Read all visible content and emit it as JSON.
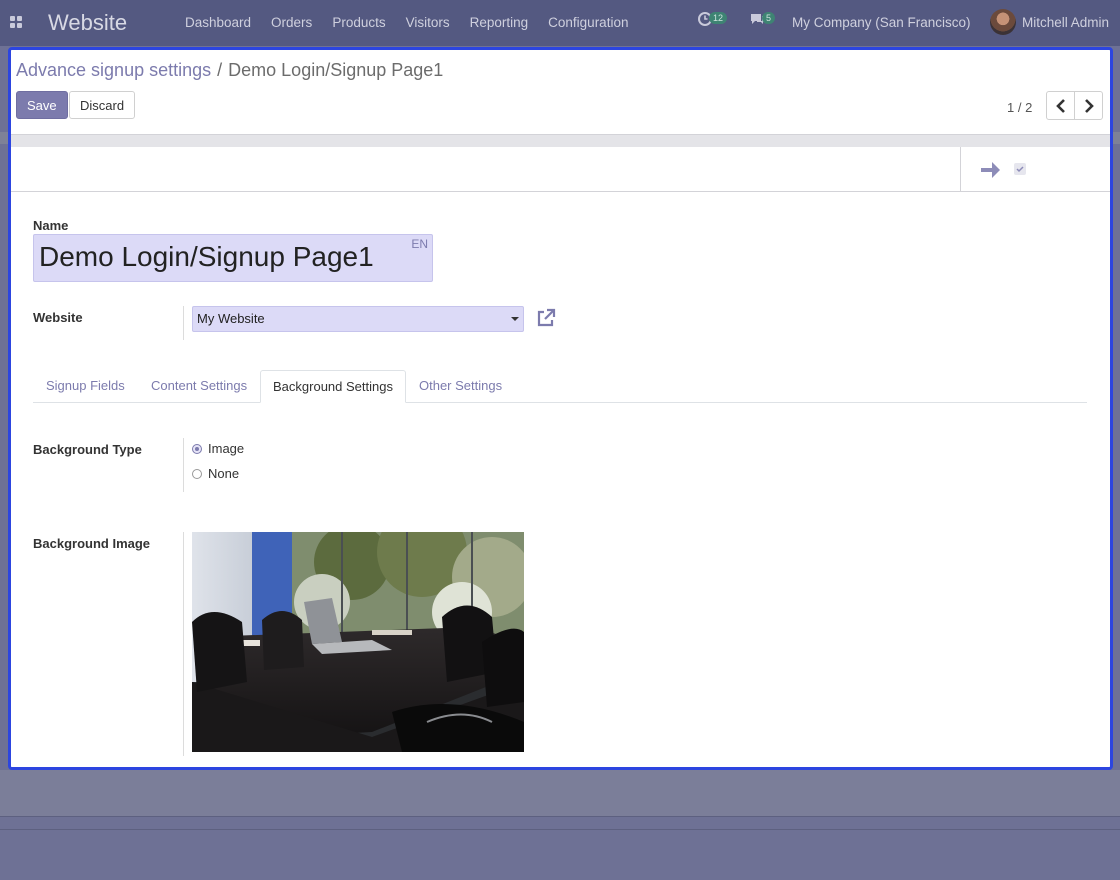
{
  "navbar": {
    "app_name": "Website",
    "menu": [
      "Dashboard",
      "Orders",
      "Products",
      "Visitors",
      "Reporting",
      "Configuration"
    ],
    "activity_count": "12",
    "messages_count": "5",
    "company": "My Company (San Francisco)",
    "user": "Mitchell Admin"
  },
  "breadcrumb": {
    "parent": "Advance signup settings",
    "separator": "/",
    "current": "Demo Login/Signup Page1"
  },
  "toolbar": {
    "save_label": "Save",
    "discard_label": "Discard",
    "pager": "1 / 2"
  },
  "form": {
    "name_label": "Name",
    "name_value": "Demo Login/Signup Page1",
    "lang": "EN",
    "website_label": "Website",
    "website_value": "My Website",
    "tabs": [
      "Signup Fields",
      "Content Settings",
      "Background Settings",
      "Other Settings"
    ],
    "active_tab": "Background Settings",
    "background_type_label": "Background Type",
    "background_type_options": [
      "Image",
      "None"
    ],
    "background_type_selected": "Image",
    "background_image_label": "Background Image"
  },
  "colors": {
    "accent": "#7c7bad",
    "navbar": "#545981",
    "highlight_border": "#2c45e0",
    "input_bg": "#dcdaf7"
  },
  "icons": [
    "apps-grid-icon",
    "clock-icon",
    "chat-icon",
    "chevron-left-icon",
    "chevron-right-icon",
    "arrow-right-icon",
    "check-icon",
    "external-link-icon",
    "caret-down-icon"
  ]
}
